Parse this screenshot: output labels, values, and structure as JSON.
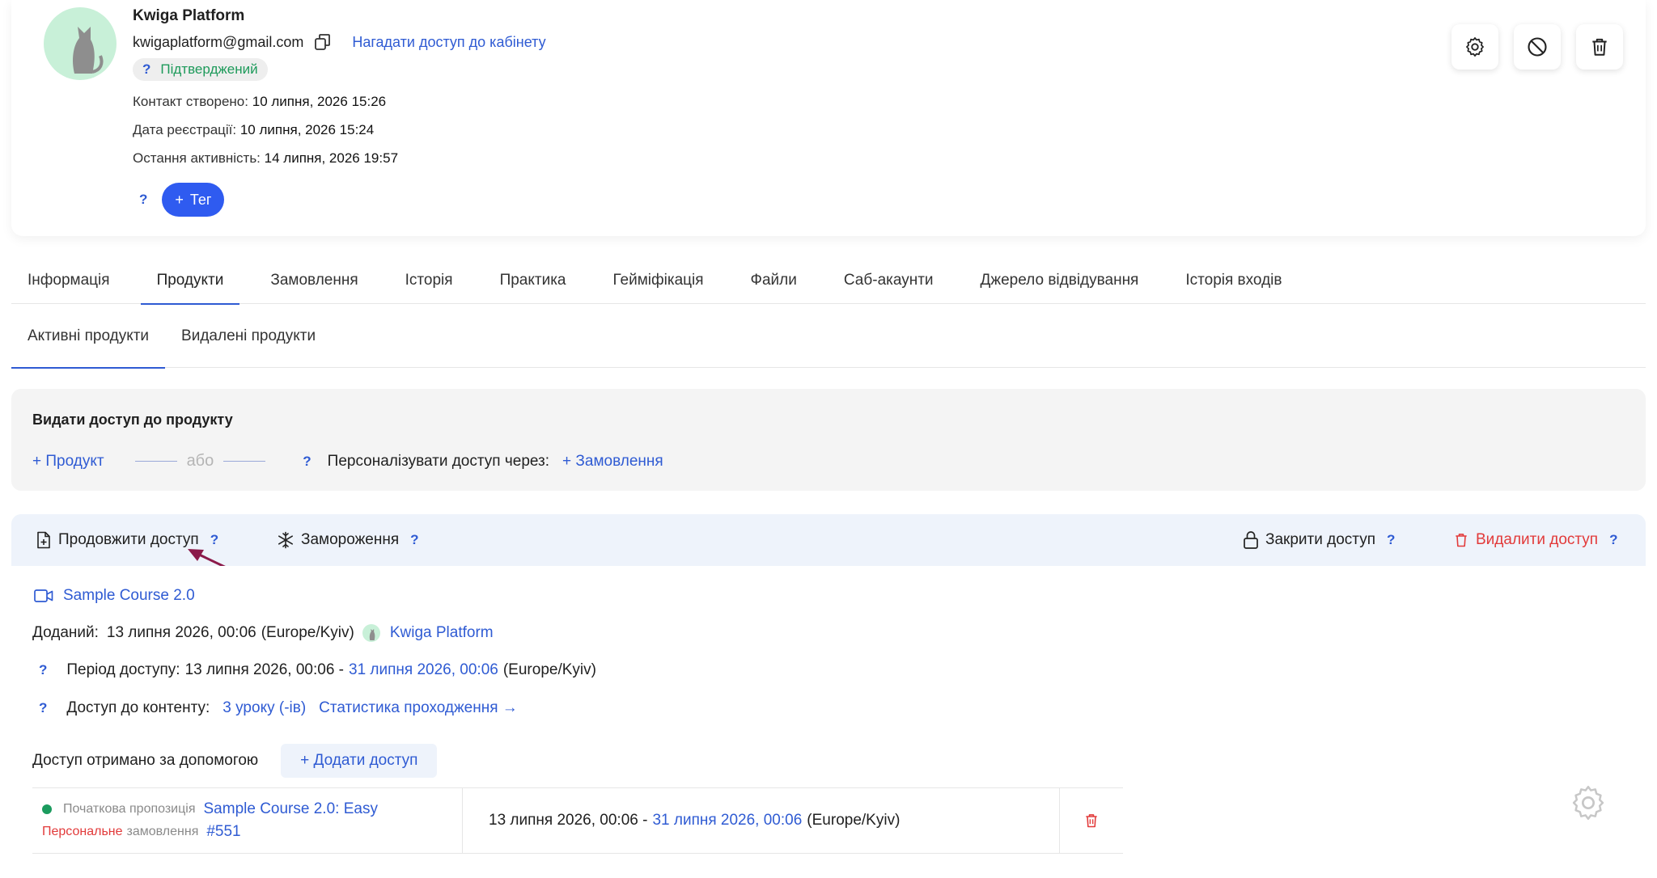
{
  "profile": {
    "name": "Kwiga Platform",
    "email": "kwigaplatform@gmail.com",
    "remind_link": "Нагадати доступ до кабінету",
    "status_help": "?",
    "status": "Підтверджений",
    "created_label": "Контакт створено:",
    "created_value": "10 липня, 2026 15:26",
    "registered_label": "Дата реєстрації:",
    "registered_value": "10 липня, 2026 15:24",
    "last_activity_label": "Остання активність:",
    "last_activity_value": "14 липня, 2026 19:57",
    "tag_help": "?",
    "tag_button": "Тег"
  },
  "main_tabs": [
    "Інформація",
    "Продукти",
    "Замовлення",
    "Історія",
    "Практика",
    "Гейміфікація",
    "Файли",
    "Саб-акаунти",
    "Джерело відвідування",
    "Історія входів"
  ],
  "sub_tabs": [
    "Активні продукти",
    "Видалені продукти"
  ],
  "grant": {
    "title": "Видати доступ до продукту",
    "add_product": "+ Продукт",
    "or": "або",
    "help": "?",
    "personalize_label": "Персоналізувати доступ через:",
    "add_order": "+ Замовлення"
  },
  "actions": {
    "extend": "Продовжити доступ",
    "freeze": "Замороження",
    "close": "Закрити доступ",
    "delete": "Видалити доступ",
    "help": "?"
  },
  "product": {
    "title": "Sample Course 2.0",
    "added_label": "Доданий:",
    "added_value": "13 липня 2026, 00:06",
    "added_tz": "(Europe/Kyiv)",
    "added_by": "Kwiga Platform",
    "period_help": "?",
    "period_label": "Період доступу:",
    "period_start": "13 липня 2026, 00:06 -",
    "period_end": "31 липня 2026, 00:06",
    "period_tz": "(Europe/Kyiv)",
    "content_help": "?",
    "content_label": "Доступ до контенту:",
    "content_lessons": "3 уроку (-ів)",
    "content_stats": "Статистика проходження →",
    "received_via_label": "Доступ отримано за допомогою",
    "add_access_button": "+ Додати доступ"
  },
  "access_row": {
    "offer_label": "Початкова пропозиція",
    "offer_name": "Sample Course 2.0: Easy",
    "order_type_red": "Персональне",
    "order_type_gray": "замовлення",
    "order_number": "#551",
    "date_start": "13 липня 2026, 00:06 -",
    "date_end": "31 липня 2026, 00:06",
    "date_tz": "(Europe/Kyiv)"
  },
  "colors": {
    "accent": "#2f5bd3",
    "danger": "#e23a3a",
    "success": "#1b9b5e",
    "annotation_arrow": "#8b1a4a"
  }
}
